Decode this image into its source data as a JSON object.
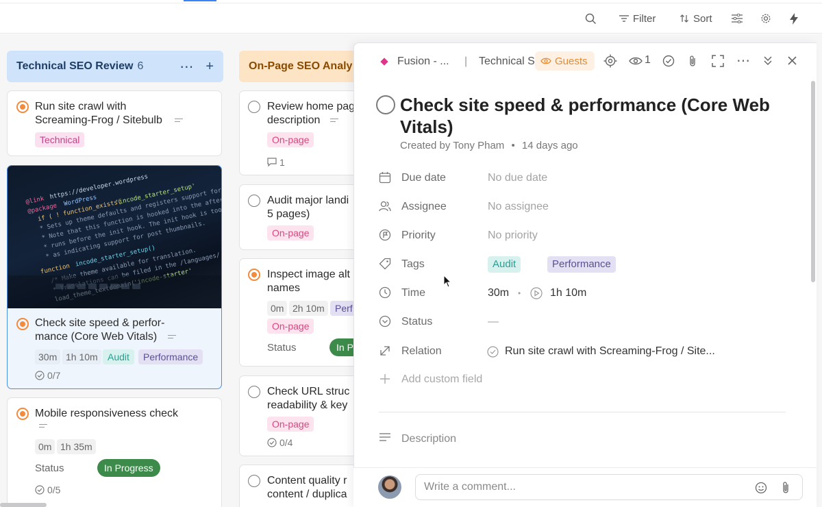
{
  "toolbar": {
    "filter_label": "Filter",
    "sort_label": "Sort"
  },
  "columns": [
    {
      "title": "Technical SEO Review",
      "count": "6"
    },
    {
      "title": "On-Page SEO Analy"
    }
  ],
  "col1_cards": {
    "card1": {
      "title_line1": "Run site crawl with",
      "title_line2": "Screaming-Frog / Sitebulb",
      "tag": "Technical"
    },
    "card2": {
      "title_line1": "Check site speed & perfor-",
      "title_line2": "mance (Core Web Vitals)",
      "time_est": "30m",
      "time_tracked": "1h 10m",
      "tag1": "Audit",
      "tag2": "Performance",
      "checklist": "0/7"
    },
    "card3": {
      "title": "Mobile responsiveness check",
      "time_est": "0m",
      "time_tracked": "1h 35m",
      "status_label": "Status",
      "status_value": "In Progress",
      "checklist": "0/5"
    }
  },
  "col2_cards": {
    "card1": {
      "title_line1": "Review home pag",
      "title_line2": "description",
      "tag": "On-page",
      "comments": "1"
    },
    "card2": {
      "title_line1": "Audit major landi",
      "title_line2": "5 pages)",
      "tag": "On-page"
    },
    "card3": {
      "title_line1": "Inspect image alt",
      "title_line2": "names",
      "time_est": "0m",
      "time_tracked": "2h 10m",
      "tag_perf": "Perf",
      "tag": "On-page",
      "status_label": "Status",
      "status_value": "In P"
    },
    "card4": {
      "title_line1": "Check URL struc",
      "title_line2": "readability & key",
      "tag": "On-page",
      "checklist": "0/4"
    },
    "card5": {
      "title_line1": "Content quality r",
      "title_line2": "content / duplica"
    }
  },
  "panel": {
    "breadcrumb_space": "Fusion - ...",
    "breadcrumb_sep": "|",
    "breadcrumb_list": "Technical S",
    "guests_label": "Guests",
    "watchers": "1",
    "title": "Check site speed & performance (Core Web Vitals)",
    "created_by": "Created by Tony Pham",
    "created_sep": "•",
    "created_ago": "14 days ago",
    "fields": {
      "due_label": "Due date",
      "due_value": "No due date",
      "assignee_label": "Assignee",
      "assignee_value": "No assignee",
      "priority_label": "Priority",
      "priority_value": "No priority",
      "tags_label": "Tags",
      "tag1": "Audit",
      "tag2": "Performance",
      "time_label": "Time",
      "time_est": "30m",
      "time_sep": "•",
      "time_tracked": "1h 10m",
      "status_label": "Status",
      "status_value": "—",
      "relation_label": "Relation",
      "relation_value": "Run site crawl with Screaming-Frog / Site...",
      "custom_field": "Add custom field",
      "description_label": "Description"
    },
    "comment_placeholder": "Write a comment..."
  },
  "colors": {
    "accent_blue": "#3b82f6",
    "col1_header": "#cfe3fa",
    "col2_header": "#fde4c5",
    "status_green": "#3d8b4a",
    "guests_orange": "#e88a2c",
    "priority_orange": "#f28b3c"
  }
}
